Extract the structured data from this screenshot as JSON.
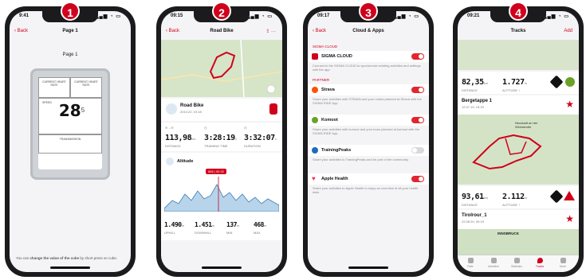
{
  "badges": [
    "1",
    "2",
    "3",
    "4"
  ],
  "phone1": {
    "time": "9:41",
    "back": "Back",
    "title": "Page 1",
    "page_label": "Page 1",
    "cells": {
      "cur_hr": "CURRENT HEART RATE",
      "cur_hr2": "CURRENT HEART RATE",
      "speed": "SPEED",
      "big_value": "28",
      "big_sup": "5",
      "trans": "TRANSMISSION"
    },
    "footer_pre": "You can ",
    "footer_bold": "change the value of the cube",
    "footer_post": " by short press on cube."
  },
  "phone2": {
    "time": "09:15",
    "back": "Back",
    "title": "Road Bike",
    "activity": "Road Bike",
    "date": "2013.22, 19:18",
    "stats": [
      {
        "value": "113,98",
        "unit": "km",
        "label": "DISTANCE"
      },
      {
        "value": "3:28:19",
        "unit": "h",
        "label": "TRAINING TIME"
      },
      {
        "value": "3:32:07",
        "unit": "h",
        "label": "DURATION"
      }
    ],
    "altitude": "Altitude",
    "tooltip_a": "868",
    "tooltip_b": "00:32",
    "bottom": [
      {
        "value": "1.490",
        "unit": "m",
        "label": "UPHILL"
      },
      {
        "value": "1.451",
        "unit": "m",
        "label": "DOWNHILL"
      },
      {
        "value": "137",
        "unit": "m",
        "label": "MIN"
      },
      {
        "value": "468",
        "unit": "m",
        "label": "MAX"
      }
    ]
  },
  "phone3": {
    "time": "09:17",
    "back": "Back",
    "title": "Cloud & Apps",
    "cloud_section": "SIGMA CLOUD",
    "cloud_label": "SIGMA CLOUD",
    "cloud_desc": "Connect to the SIGMA CLOUD to synchronize existing activities and settings with the app.",
    "partner_section": "PARTNER",
    "apps": [
      {
        "label": "Strava",
        "desc": "Share your activities with STRAVA and your routes planned at Strava with the SIGMA RIDE App."
      },
      {
        "label": "Komoot",
        "desc": "Share your activities with komoot and your tours planned at komoot with the SIGMA RIDE App."
      },
      {
        "label": "TrainingPeaks",
        "desc": "Share your activities to TrainingPeaks and be part of the community."
      },
      {
        "label": "Apple Health",
        "desc": "Share your activities to Apple Health to enjoy an overview of all your health data."
      }
    ],
    "colors": {
      "strava": "#fc5200",
      "komoot": "#6aa127",
      "tp": "#1c6bc1",
      "health": "#ff2d55",
      "on": "#e0262f",
      "off": "#d9d9d9"
    }
  },
  "phone4": {
    "time": "09:21",
    "title": "Tracks",
    "add": "Add",
    "track1": {
      "dist": "82,35",
      "dist_unit": "km",
      "alt": "1.727",
      "alt_unit": "m",
      "dist_label": "DISTANCE",
      "alt_label": "ALTITUDE ↑"
    },
    "track2_name": "Bergetappe 1",
    "track2_date": "12.07.19, 19:33",
    "map_label": "Neustadt an der Weinstraße",
    "track3": {
      "dist": "93,61",
      "dist_unit": "km",
      "alt": "2.112",
      "alt_unit": "m",
      "dist_label": "DISTANCE",
      "alt_label": "ALTITUDE ↑"
    },
    "track4_name": "Tirolrour_1",
    "track4_date": "22.08.20, 09:19",
    "map2_label": "INNSBRUCK",
    "tabs": [
      "Ride",
      "Activities",
      "Statistics",
      "Tracks",
      "More"
    ]
  }
}
